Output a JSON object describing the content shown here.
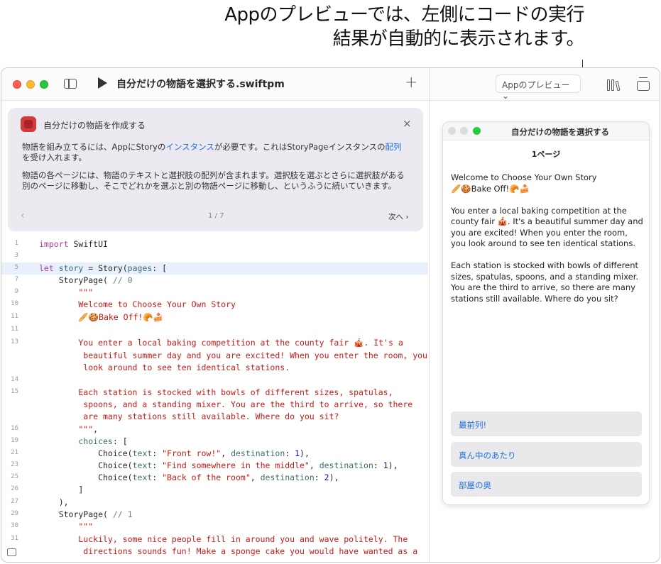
{
  "callout": {
    "line1": "Appのプレビューでは、左側にコードの実行",
    "line2": "結果が自動的に表示されます。"
  },
  "toolbar": {
    "project_title": "自分だけの物語を選択する.swiftpm",
    "add_label": "+",
    "preview_menu": "Appのプレビュー ⌄"
  },
  "tutorial": {
    "title": "自分だけの物語を作成する",
    "close": "×",
    "p1_a": "物語を組み立てるには、AppにStoryの",
    "p1_link1": "インスタンス",
    "p1_b": "が必要です。これはStoryPageインスタンスの",
    "p1_link2": "配列",
    "p1_c": "を受け入れます。",
    "p2": "物語の各ページには、物語のテキストと選択肢の配列が含まれます。選択肢を選ぶとさらに選択肢がある別のページに移動し、そこでどれかを選ぶと別の物語ページに移動し、というふうに続いていきます。",
    "prev": "‹",
    "page": "1 / 7",
    "next": "次へ ›"
  },
  "code": {
    "line_numbers": [
      "1",
      "3",
      "5",
      "7",
      "9",
      "10",
      "11",
      "11",
      "13",
      "",
      "",
      "14",
      "15",
      "",
      "",
      "16",
      "19",
      "21",
      "23",
      "25",
      "26",
      "27",
      "29",
      "30",
      "31",
      ""
    ],
    "l1_kw": "import",
    "l1_rest": " SwiftUI",
    "l5_kw": "let",
    "l5_name": " story",
    "l5_a": " = Story(",
    "l5_prop": "pages",
    "l5_b": ": [",
    "l7_a": "    StoryPage( ",
    "l7_cmt": "// 0",
    "l9": "        \"\"\"",
    "l10": "        Welcome to Choose Your Own Story",
    "l11": "        🥖🍪Bake Off!🥐🍰",
    "l13a": "        You enter a local baking competition at the county fair 🎪. It's a",
    "l13b": "         beautiful summer day and you are excited! When you enter the room, you",
    "l13c": "         look around to see ten identical stations.",
    "l15a": "        Each station is stocked with bowls of different sizes, spatulas,",
    "l15b": "         spoons, and a standing mixer. You are the third to arrive, so there",
    "l15c": "         are many stations still available. Where do you sit?",
    "l16_str": "        \"\"\"",
    "l16_rest": ",",
    "l19_prop": "        choices",
    "l19_rest": ": [",
    "c1_a": "            Choice(",
    "c1_text": "text",
    "c1_str": "\"Front row!\"",
    "c1_dest": "destination",
    "c1_num": "1",
    "c2_str": "\"Find somewhere in the middle\"",
    "c2_num": "1",
    "c3_str": "\"Back of the room\"",
    "c3_num": "2",
    "l25": "        ]",
    "l26": "    ),",
    "l27_a": "    StoryPage( ",
    "l27_cmt": "// 1",
    "l29": "        \"\"\"",
    "l30": "        Luckily, some nice people fill in around you and wave politely. The",
    "l31": "         directions sounds fun! Make a sponge cake you would have wanted as a"
  },
  "preview": {
    "window_title": "自分だけの物語を選択する",
    "page_label": "1ページ",
    "story_text": "Welcome to Choose Your Own Story\n🥖🍪Bake Off!🥐🍰\n\nYou enter a local baking competition at the county fair 🎪. It's a beautiful summer day and you are excited! When you enter the room, you look around to see ten identical stations.\n\nEach station is stocked with bowls of different sizes, spatulas, spoons, and a standing mixer. You are the third to arrive, so there are many stations still available. Where do you sit?",
    "choices": [
      "最前列!",
      "真ん中のあたり",
      "部屋の奥"
    ]
  },
  "colors": {
    "keyword": "#ad3da4",
    "string": "#c41a16",
    "number": "#1c00cf",
    "link": "#1f6fe0"
  }
}
